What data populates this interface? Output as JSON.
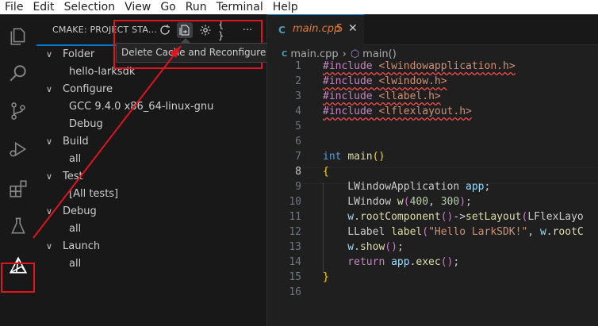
{
  "menubar": {
    "items": [
      "File",
      "Edit",
      "Selection",
      "View",
      "Go",
      "Run",
      "Terminal",
      "Help"
    ]
  },
  "activity_bar": {
    "icons": [
      "explorer-icon",
      "search-icon",
      "source-control-icon",
      "run-debug-icon",
      "extensions-icon",
      "testing-icon",
      "cmake-icon"
    ],
    "selected": "cmake-icon"
  },
  "sidebar": {
    "title": "CMAKE: PROJECT STA...",
    "actions": [
      "refresh-icon",
      "delete-cache-icon",
      "gear-icon",
      "braces-icon",
      "more-icon"
    ],
    "tooltip": "Delete Cache and Reconfigure",
    "tree": [
      {
        "label": "Folder",
        "level": 0
      },
      {
        "label": "hello-larksdk",
        "level": 1
      },
      {
        "label": "Configure",
        "level": 0
      },
      {
        "label": "GCC 9.4.0 x86_64-linux-gnu",
        "level": 1
      },
      {
        "label": "Debug",
        "level": 1
      },
      {
        "label": "Build",
        "level": 0
      },
      {
        "label": "all",
        "level": 1
      },
      {
        "label": "Test",
        "level": 0
      },
      {
        "label": "[All tests]",
        "level": 1
      },
      {
        "label": "Debug",
        "level": 0
      },
      {
        "label": "all",
        "level": 1
      },
      {
        "label": "Launch",
        "level": 0
      },
      {
        "label": "all",
        "level": 1
      }
    ]
  },
  "editor": {
    "tab": {
      "name": "main.cpp",
      "count": "5",
      "icon": "C"
    },
    "breadcrumb": {
      "file": "main.cpp",
      "symbol": "main()"
    },
    "current_line": 8,
    "lines": [
      {
        "n": "1",
        "segs": [
          [
            "pp squig",
            "#include "
          ],
          [
            "str squig",
            "<lwindowapplication.h>"
          ]
        ]
      },
      {
        "n": "2",
        "segs": [
          [
            "pp squig",
            "#include "
          ],
          [
            "str squig",
            "<lwindow.h>"
          ]
        ]
      },
      {
        "n": "3",
        "segs": [
          [
            "pp squig",
            "#include "
          ],
          [
            "str squig",
            "<llabel.h>"
          ]
        ]
      },
      {
        "n": "4",
        "segs": [
          [
            "pp squig",
            "#include "
          ],
          [
            "str squig",
            "<lflexlayout.h>"
          ]
        ]
      },
      {
        "n": "5",
        "segs": []
      },
      {
        "n": "6",
        "segs": []
      },
      {
        "n": "7",
        "segs": [
          [
            "kw",
            "int "
          ],
          [
            "fn",
            "main"
          ],
          [
            "br",
            "()"
          ]
        ]
      },
      {
        "n": "8",
        "segs": [
          [
            "br",
            "{"
          ]
        ]
      },
      {
        "n": "9",
        "segs": [
          [
            "",
            "    LWindowApplication "
          ],
          [
            "var",
            "app"
          ],
          [
            "",
            ";"
          ]
        ]
      },
      {
        "n": "10",
        "segs": [
          [
            "",
            "    LWindow "
          ],
          [
            "fn",
            "w"
          ],
          [
            "br2",
            "("
          ],
          [
            "num",
            "400"
          ],
          [
            "",
            ", "
          ],
          [
            "num",
            "300"
          ],
          [
            "br2",
            ")"
          ],
          [
            "",
            ";"
          ]
        ]
      },
      {
        "n": "11",
        "segs": [
          [
            "var",
            "    w"
          ],
          [
            "",
            "."
          ],
          [
            "fn",
            "rootComponent"
          ],
          [
            "br2",
            "()"
          ],
          [
            "",
            "->"
          ],
          [
            "fn",
            "setLayout"
          ],
          [
            "br2",
            "("
          ],
          [
            "",
            "LFlexLayo"
          ]
        ]
      },
      {
        "n": "12",
        "segs": [
          [
            "",
            "    LLabel "
          ],
          [
            "fn",
            "label"
          ],
          [
            "br2",
            "("
          ],
          [
            "str",
            "\"Hello LarkSDK!\""
          ],
          [
            "",
            ", "
          ],
          [
            "var",
            "w"
          ],
          [
            "",
            "."
          ],
          [
            "fn",
            "rootC"
          ]
        ]
      },
      {
        "n": "13",
        "segs": [
          [
            "var",
            "    w"
          ],
          [
            "",
            "."
          ],
          [
            "fn",
            "show"
          ],
          [
            "br2",
            "()"
          ],
          [
            "",
            ";"
          ]
        ]
      },
      {
        "n": "14",
        "segs": [
          [
            "pp",
            "    return "
          ],
          [
            "var",
            "app"
          ],
          [
            "",
            "."
          ],
          [
            "fn",
            "exec"
          ],
          [
            "br2",
            "()"
          ],
          [
            "",
            ";"
          ]
        ]
      },
      {
        "n": "15",
        "segs": [
          [
            "br",
            "}"
          ]
        ]
      },
      {
        "n": "16",
        "segs": []
      }
    ]
  },
  "colors": {
    "highlight": "#e0141e",
    "accent": "#0078d4"
  }
}
